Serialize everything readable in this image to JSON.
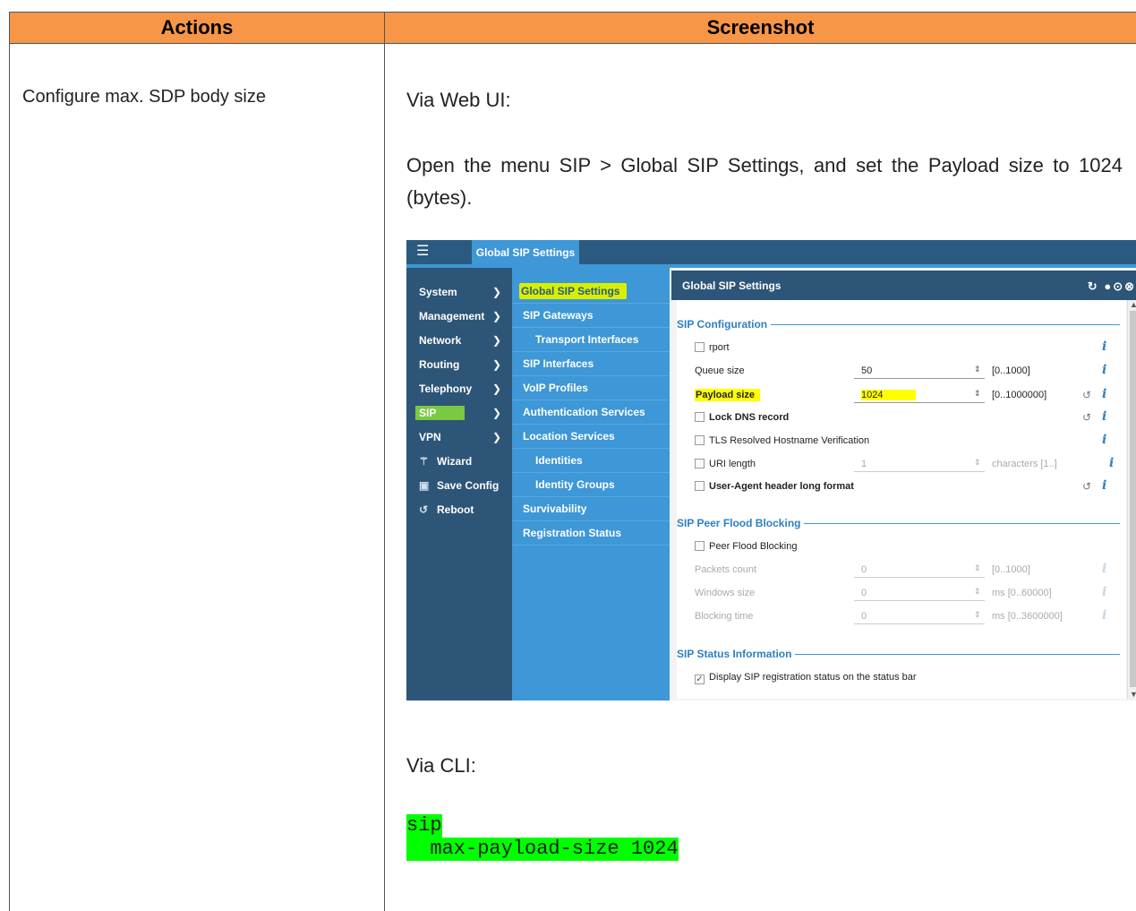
{
  "table": {
    "headers": {
      "actions": "Actions",
      "screenshot": "Screenshot"
    },
    "action_text": "Configure max. SDP body size",
    "para_web": "Via Web UI:",
    "para_instr": "Open the menu SIP > Global SIP Settings, and set the Payload size to 1024 (bytes).",
    "para_cli": "Via CLI:",
    "cli": {
      "line1": "sip",
      "line2": "  max-payload-size 1024"
    }
  },
  "ui": {
    "top_tab": "Global SIP Settings",
    "nav1": [
      {
        "label": "System",
        "chev": "❯"
      },
      {
        "label": "Management",
        "chev": "❯"
      },
      {
        "label": "Network",
        "chev": "❯"
      },
      {
        "label": "Routing",
        "chev": "❯"
      },
      {
        "label": "Telephony",
        "chev": "❯"
      },
      {
        "label": "SIP",
        "chev": "❯"
      },
      {
        "label": "VPN",
        "chev": "❯"
      },
      {
        "label": "Wizard",
        "icon": "wand-icon"
      },
      {
        "label": "Save Config",
        "icon": "floppy-icon"
      },
      {
        "label": "Reboot",
        "icon": "reboot-icon"
      }
    ],
    "nav2": [
      {
        "label": "Global SIP Settings"
      },
      {
        "label": "SIP Gateways"
      },
      {
        "label": "Transport Interfaces"
      },
      {
        "label": "SIP Interfaces"
      },
      {
        "label": "VoIP Profiles"
      },
      {
        "label": "Authentication Services"
      },
      {
        "label": "Location Services"
      },
      {
        "label": "Identities"
      },
      {
        "label": "Identity Groups"
      },
      {
        "label": "Survivability"
      },
      {
        "label": "Registration Status"
      }
    ],
    "panel": {
      "title": "Global SIP Settings",
      "sections": {
        "sip_config": "SIP Configuration",
        "peer_flood": "SIP Peer Flood Blocking",
        "status_info": "SIP Status Information"
      },
      "fields": {
        "rport": "rport",
        "queue_size": {
          "label": "Queue size",
          "value": "50",
          "range": "[0..1000]"
        },
        "payload_size": {
          "label": "Payload size",
          "value": "1024",
          "range": "[0..1000000]"
        },
        "lock_dns": "Lock DNS record",
        "tls_verif": "TLS Resolved Hostname Verification",
        "uri_length": {
          "label": "URI length",
          "value": "1",
          "range": "characters [1..]"
        },
        "ua_long": "User-Agent header long format",
        "peer_flood_blocking": "Peer Flood Blocking",
        "packets_count": {
          "label": "Packets count",
          "value": "0",
          "range": "[0..1000]"
        },
        "windows_size": {
          "label": "Windows size",
          "value": "0",
          "range": "ms [0..60000]"
        },
        "blocking_time": {
          "label": "Blocking time",
          "value": "0",
          "range": "ms [0..3600000]"
        },
        "display_status": "Display SIP registration status on the status bar"
      }
    }
  }
}
